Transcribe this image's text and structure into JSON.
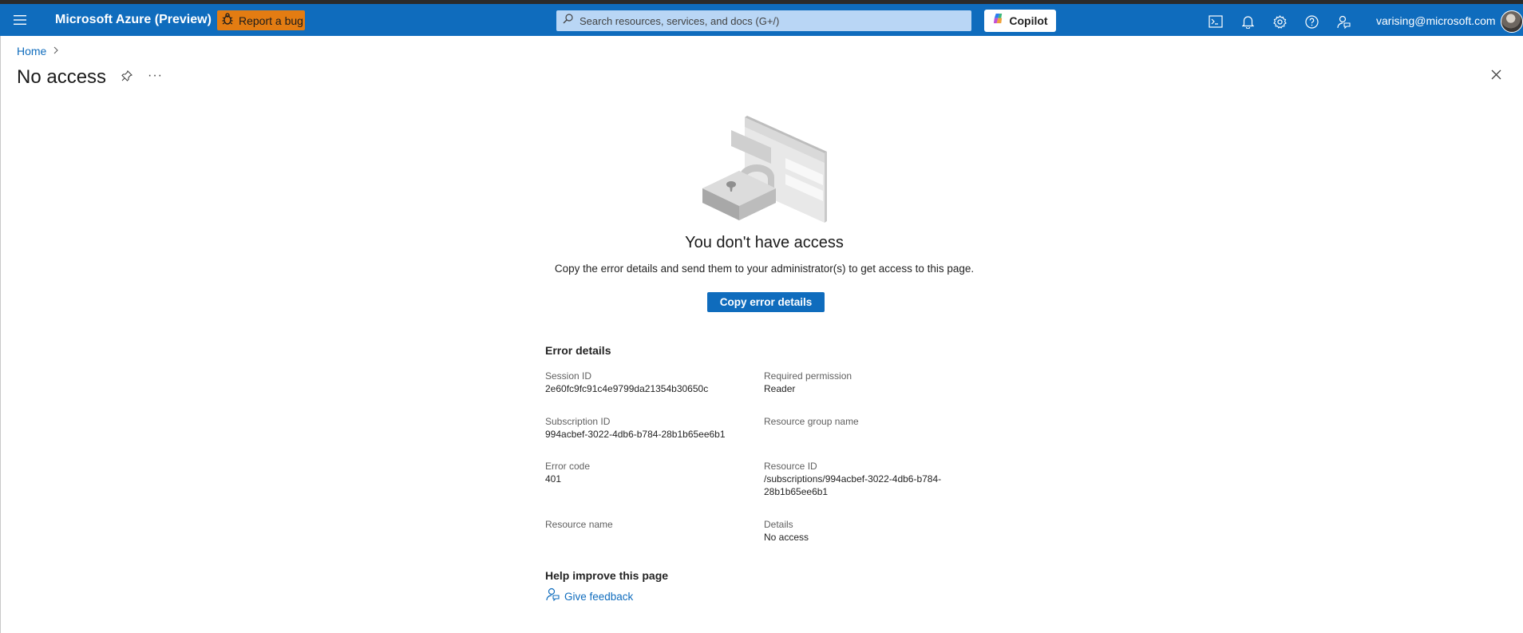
{
  "topbar": {
    "app_title": "Microsoft Azure (Preview)",
    "report_bug_label": "Report a bug",
    "search_placeholder": "Search resources, services, and docs (G+/)",
    "copilot_label": "Copilot",
    "user_email": "varising@microsoft.com",
    "icons": [
      "menu-icon",
      "bug-icon",
      "search-icon",
      "copilot-icon",
      "cloud-shell-icon",
      "bell-icon",
      "gear-icon",
      "help-icon",
      "feedback-icon",
      "avatar"
    ],
    "colors": {
      "bar": "#0f6cbd",
      "bug_button": "#e37c12",
      "search_bg": "#b9d6f5"
    }
  },
  "breadcrumb": {
    "home": "Home"
  },
  "header": {
    "title": "No access",
    "more": "···"
  },
  "main": {
    "heading": "You don't have access",
    "subtext": "Copy the error details and send them to your administrator(s) to get access to this page.",
    "copy_button": "Copy error details",
    "error_details": {
      "title": "Error details",
      "fields": [
        {
          "key": "Session ID",
          "value": "2e60fc9fc91c4e9799da21354b30650c"
        },
        {
          "key": "Required permission",
          "value": "Reader"
        },
        {
          "key": "Subscription ID",
          "value": "994acbef-3022-4db6-b784-28b1b65ee6b1"
        },
        {
          "key": "Resource group name",
          "value": ""
        },
        {
          "key": "Error code",
          "value": "401"
        },
        {
          "key": "Resource ID",
          "value": "/subscriptions/994acbef-3022-4db6-b784-\n28b1b65ee6b1"
        },
        {
          "key": "Resource name",
          "value": ""
        },
        {
          "key": "Details",
          "value": "No access"
        }
      ]
    },
    "help": {
      "title": "Help improve this page",
      "feedback_label": "Give feedback"
    }
  },
  "accent": "#0f6cbd"
}
